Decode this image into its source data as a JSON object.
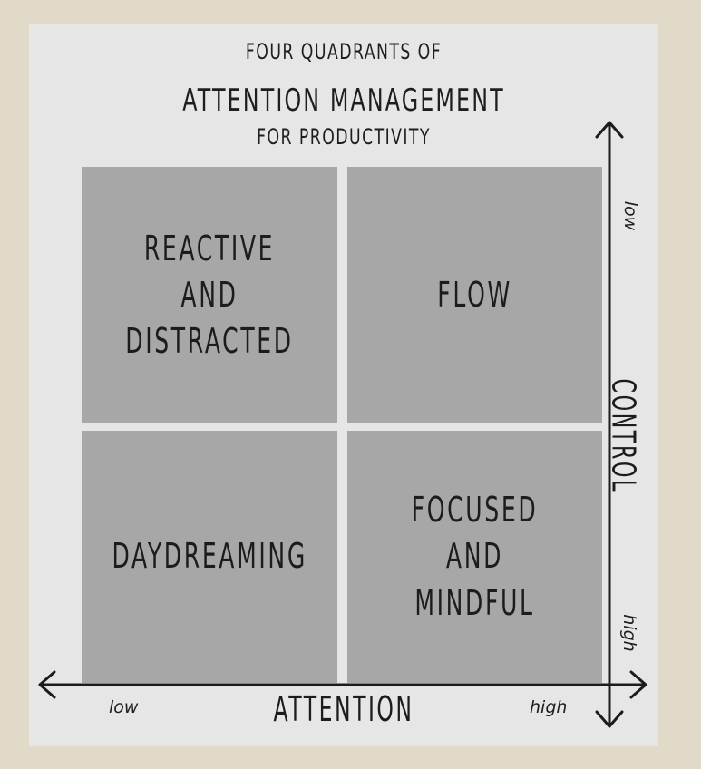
{
  "title": {
    "line1": "FOUR QUADRANTS OF",
    "line2": "ATTENTION MANAGEMENT",
    "line3": "FOR PRODUCTIVITY"
  },
  "quadrants": {
    "top_left": "REACTIVE AND\nDISTRACTED",
    "top_right": "FLOW",
    "bottom_left": "DAYDREAMING",
    "bottom_right": "FOCUSED\nAND MINDFUL"
  },
  "x_axis": {
    "label": "ATTENTION",
    "low": "low",
    "high": "high"
  },
  "y_axis": {
    "label": "CONTROL",
    "low": "low",
    "high": "high"
  },
  "colors": {
    "background": "#e2dac9",
    "card": "#e6e6e6",
    "quadrant_fill": "#a7a7a7",
    "ink": "#1c1c1c"
  }
}
